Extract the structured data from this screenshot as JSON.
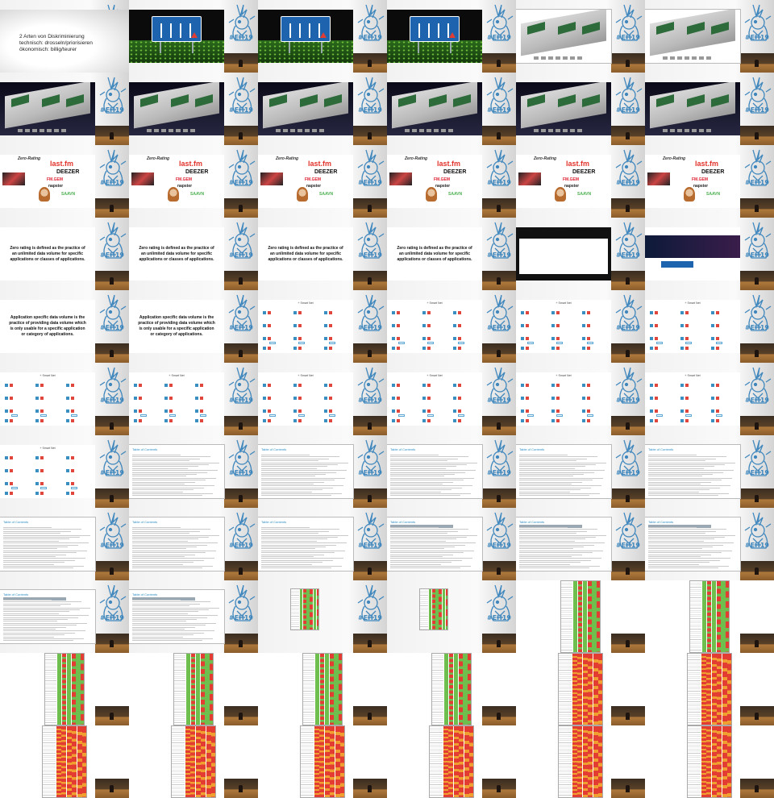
{
  "grid": {
    "columns": 6,
    "rows": 11
  },
  "hashtag": "#EH19",
  "colors": {
    "accent": "#3f87bd",
    "table_green": "#6fbf4e",
    "table_red": "#e23c33",
    "table_orange": "#f0a030",
    "sign_blue": "#1e63ad"
  },
  "slide_text": {
    "discrimination": {
      "lines": [
        "2 Arten von Diskriminierung",
        "technisch: drosseln/priorisieren",
        "ökonomisch: billig/teurer"
      ]
    },
    "zero_rating_title": "Zero-Rating",
    "zero_rating_logos": [
      "last.fm",
      "DEEZER",
      "FM.GEM",
      "napster",
      "SAAVN"
    ],
    "zero_rating_definition": "Zero rating is defined as the practice of an unlimited data volume for specific applications or classes of applications.",
    "application_specific_definition": "Application specific data volume is the practice of providing data volume which is only usable for a specific application or category of applications.",
    "smart_net_title": "+ Smart Net",
    "toc_title": "Table of Contents"
  },
  "cells": [
    "discrimination",
    "sign",
    "sign",
    "sign",
    "cartoon-light",
    "cartoon-light",
    "cartoon-dark",
    "cartoon-dark",
    "cartoon-dark",
    "cartoon-dark",
    "cartoon-dark",
    "cartoon-dark",
    "zero",
    "zero",
    "zero",
    "zero",
    "zero",
    "zero",
    "def-zero",
    "def-zero",
    "def-zero",
    "def-zero",
    "web-offers",
    "web-hero",
    "def-app",
    "def-app",
    "smartnet",
    "smartnet",
    "smartnet",
    "smartnet",
    "smartnet",
    "smartnet",
    "smartnet",
    "smartnet",
    "smartnet",
    "smartnet",
    "smartnet",
    "toc",
    "toc",
    "toc",
    "toc",
    "toc",
    "toc",
    "toc",
    "toc",
    "toc-hl",
    "toc-hl",
    "toc-hl",
    "toc-hl",
    "toc-hl",
    "table-small",
    "table-small",
    "table-tall",
    "table-tall",
    "table-full",
    "table-full",
    "table-full",
    "table-full",
    "table-red",
    "table-red",
    "table-red",
    "table-red",
    "table-red",
    "table-red",
    "table-red",
    "table-red"
  ]
}
